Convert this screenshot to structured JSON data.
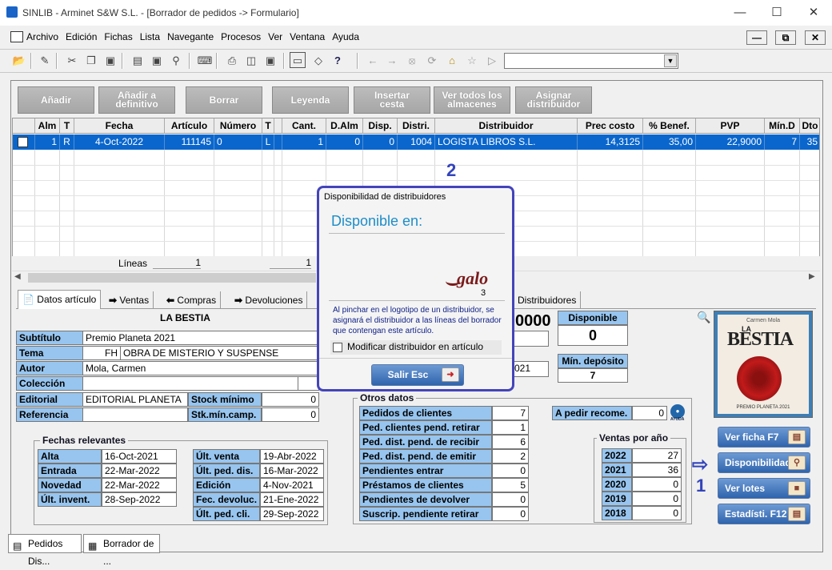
{
  "window": {
    "title": "SINLIB - Arminet S&W S.L. - [Borrador de pedidos -> Formulario]"
  },
  "menu": [
    "Archivo",
    "Edición",
    "Fichas",
    "Lista",
    "Navegante",
    "Procesos",
    "Ver",
    "Ventana",
    "Ayuda"
  ],
  "action_buttons": [
    {
      "l1": "Añadir",
      "l2": ""
    },
    {
      "l1": "Añadir a",
      "l2": "definitivo"
    },
    {
      "l1": "Borrar",
      "l2": ""
    },
    {
      "l1": "Leyenda",
      "l2": ""
    },
    {
      "l1": "Insertar",
      "l2": "cesta"
    },
    {
      "l1": "Ver todos los",
      "l2": "almacenes"
    },
    {
      "l1": "Asignar",
      "l2": "distribuidor"
    }
  ],
  "grid": {
    "headers": [
      "",
      "Alm",
      "T",
      "Fecha",
      "Artículo",
      "Número",
      "T",
      "",
      "Cant.",
      "D.Alm",
      "Disp.",
      "Distri.",
      "Distribuidor",
      "Prec costo",
      "% Benef.",
      "PVP",
      "Mín.D",
      "Dto"
    ],
    "row": [
      "",
      "1",
      "R",
      "4-Oct-2022",
      "111145",
      "0",
      "L",
      "",
      "1",
      "0",
      "0",
      "1004",
      "LOGISTA LIBROS S.L.",
      "14,3125",
      "35,00",
      "22,9000",
      "7",
      "35"
    ],
    "lineas_label": "Líneas",
    "lineas_val1": "1",
    "lineas_val2": "1"
  },
  "tabs": [
    "Datos artículo",
    "Ventas",
    "Compras",
    "Devoluciones",
    "Distribuidores"
  ],
  "article": {
    "title": "LA BESTIA",
    "subtitulo_label": "Subtítulo",
    "subtitulo": "Premio Planeta 2021",
    "tema_label": "Tema",
    "tema_code": "FH",
    "tema": "OBRA DE MISTERIO Y SUSPENSE",
    "autor_label": "Autor",
    "autor": "Mola, Carmen",
    "coleccion_label": "Colección",
    "editorial_label": "Editorial",
    "editorial": "EDITORIAL PLANETA",
    "referencia_label": "Referencia",
    "stock_min_label": "Stock mínimo",
    "stock_min": "0",
    "stk_min_camp_label": "Stk.mín.camp.",
    "stk_min_camp": "0",
    "price_partial": "0000",
    "date_partial": "021"
  },
  "fechas": {
    "title": "Fechas relevantes",
    "left": [
      [
        "Alta",
        "16-Oct-2021"
      ],
      [
        "Entrada",
        "22-Mar-2022"
      ],
      [
        "Novedad",
        "22-Mar-2022"
      ],
      [
        "Últ. invent.",
        "28-Sep-2022"
      ]
    ],
    "right": [
      [
        "Últ. venta",
        "19-Abr-2022"
      ],
      [
        "Últ. ped. dis.",
        "16-Mar-2022"
      ],
      [
        "Edición",
        "4-Nov-2021"
      ],
      [
        "Fec. devoluc.",
        "21-Ene-2022"
      ],
      [
        "Últ. ped. cli.",
        "29-Sep-2022"
      ]
    ]
  },
  "otros": {
    "title": "Otros datos",
    "rows": [
      [
        "Pedidos de clientes",
        "7"
      ],
      [
        "Ped. clientes pend. retirar",
        "1"
      ],
      [
        "Ped. dist. pend. de recibir",
        "6"
      ],
      [
        "Ped. dist. pend. de emitir",
        "2"
      ],
      [
        "Pendientes entrar",
        "0"
      ],
      [
        "Préstamos de clientes",
        "5"
      ],
      [
        "Pendientes de devolver",
        "0"
      ],
      [
        "Suscrip. pendiente retirar",
        "0"
      ]
    ]
  },
  "disponible": {
    "label": "Disponible",
    "value": "0"
  },
  "min_deposito": {
    "label": "Mín. depósito",
    "value": "7"
  },
  "a_pedir": {
    "label": "A pedir recome.",
    "value": "0",
    "help": "AYUDA"
  },
  "ventas": {
    "title": "Ventas por año",
    "rows": [
      [
        "2022",
        "27"
      ],
      [
        "2021",
        "36"
      ],
      [
        "2020",
        "0"
      ],
      [
        "2019",
        "0"
      ],
      [
        "2018",
        "0"
      ]
    ]
  },
  "cover": {
    "author": "Carmen Mola",
    "title": "BESTIA",
    "prefix": "LA",
    "award": "PREMIO PLANETA 2021"
  },
  "right_buttons": [
    "Ver ficha F7",
    "Disponibilidad",
    "Ver lotes",
    "Estadísti. F12"
  ],
  "popup": {
    "title": "Disponibilidad de distribuidores",
    "heading": "Disponible en:",
    "logo_text": "galo",
    "logo_count": "3",
    "info": "Al pinchar en el logotipo de un distribuidor, se asignará el distribuidor a las líneas del borrador que contengan este artículo.",
    "checkbox_label": "Modificar distribuidor en artículo",
    "exit_button": "Salir Esc"
  },
  "annotations": {
    "one": "1",
    "two": "2"
  },
  "taskbar": [
    "Pedidos Dis...",
    "Borrador de ..."
  ]
}
